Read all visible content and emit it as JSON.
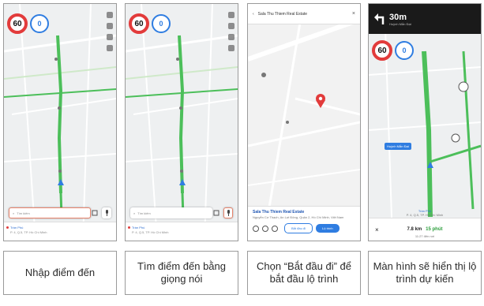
{
  "panels": [
    {
      "caption": "Nhập điểm đến",
      "speed_limit": "60",
      "current_speed": "0",
      "search_placeholder": "Tìm kiếm",
      "recent_title": "Trần Phú",
      "recent_sub": "P. 4, Q.5, TP. Hồ Chí Minh"
    },
    {
      "caption": "Tìm điểm đến bằng giọng nói",
      "speed_limit": "60",
      "current_speed": "0",
      "search_placeholder": "Tìm kiếm",
      "recent_title": "Trần Phú",
      "recent_sub": "P. 4, Q.5, TP. Hồ Chí Minh"
    },
    {
      "caption": "Chọn “Bắt đầu đi” để bắt đầu lộ trình",
      "search_value": "Sala Thu Thiem Real Estate",
      "place_title": "Sala Thu Thiem Real Estate",
      "place_sub": "Nguyễn Cơ Thạch, An Lợi Đông, Quận 2, Hồ Chí Minh, Việt Nam",
      "start_label": "Bắt đầu đi",
      "route_label": "Lộ trình"
    },
    {
      "caption": "Màn hình sẽ hiển thị lộ trình dự kiến",
      "distance": "30m",
      "street": "Huỳnh Mẫn Đạt",
      "speed_limit": "60",
      "current_speed": "0",
      "street_tag": "Huỳnh Mẫn Đạt",
      "dest_title": "Trần Phú",
      "dest_sub": "P. 4, Q.5, TP. Hồ Chí Minh",
      "trip_distance": "7.8 km",
      "trip_time": "15 phút",
      "arrival": "11:27 đến nơi"
    }
  ],
  "colors": {
    "route_green": "#4cbf5a",
    "speed_red": "#e23b3b",
    "accent_blue": "#2f7de1",
    "highlight": "#e8846c"
  }
}
